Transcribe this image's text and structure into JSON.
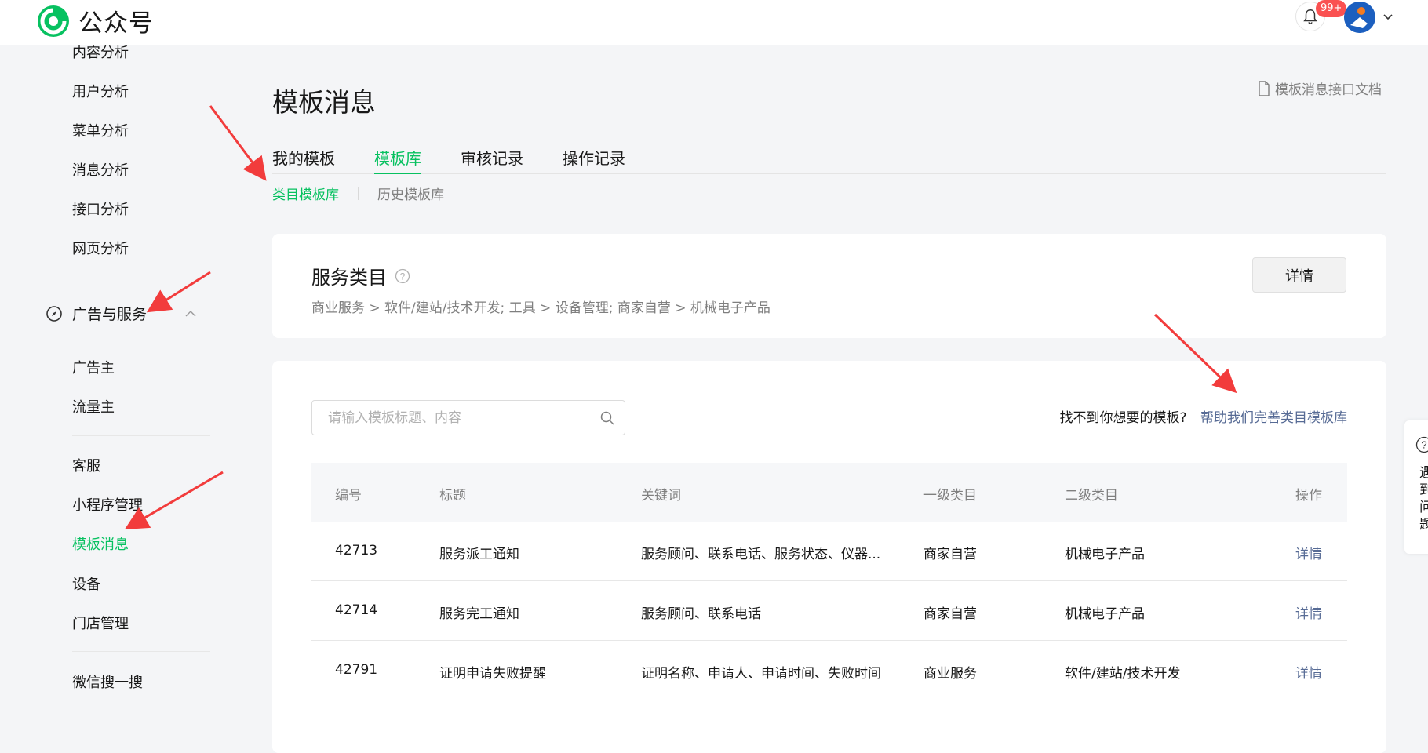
{
  "header": {
    "logo_text": "公众号",
    "notification_badge": "99+"
  },
  "sidebar": {
    "items_top": [
      {
        "label": "内容分析"
      },
      {
        "label": "用户分析"
      },
      {
        "label": "菜单分析"
      },
      {
        "label": "消息分析"
      },
      {
        "label": "接口分析"
      },
      {
        "label": "网页分析"
      }
    ],
    "group_label": "广告与服务",
    "group_items": [
      {
        "label": "广告主"
      },
      {
        "label": "流量主"
      }
    ],
    "items_bottom": [
      {
        "label": "客服"
      },
      {
        "label": "小程序管理"
      },
      {
        "label": "模板消息",
        "active": true
      },
      {
        "label": "设备"
      },
      {
        "label": "门店管理"
      }
    ],
    "items_last": [
      {
        "label": "微信搜一搜"
      }
    ]
  },
  "main": {
    "title": "模板消息",
    "doc_link": "模板消息接口文档",
    "tabs": [
      {
        "label": "我的模板"
      },
      {
        "label": "模板库",
        "active": true
      },
      {
        "label": "审核记录"
      },
      {
        "label": "操作记录"
      }
    ],
    "subtabs": [
      {
        "label": "类目模板库",
        "active": true
      },
      {
        "label": "历史模板库"
      }
    ],
    "service": {
      "title": "服务类目",
      "path": "商业服务 > 软件/建站/技术开发; 工具 > 设备管理; 商家自营 > 机械电子产品",
      "detail_button": "详情"
    },
    "search": {
      "placeholder": "请输入模板标题、内容",
      "value": ""
    },
    "help_question": "找不到你想要的模板?",
    "help_link": "帮助我们完善类目模板库",
    "table": {
      "headers": [
        "编号",
        "标题",
        "关键词",
        "一级类目",
        "二级类目",
        "操作"
      ],
      "rows": [
        {
          "id": "42713",
          "title": "服务派工通知",
          "keywords": "服务顾问、联系电话、服务状态、仪器...",
          "cat1": "商家自营",
          "cat2": "机械电子产品",
          "action": "详情"
        },
        {
          "id": "42714",
          "title": "服务完工通知",
          "keywords": "服务顾问、联系电话",
          "cat1": "商家自营",
          "cat2": "机械电子产品",
          "action": "详情"
        },
        {
          "id": "42791",
          "title": "证明申请失败提醒",
          "keywords": "证明名称、申请人、申请时间、失败时间",
          "cat1": "商业服务",
          "cat2": "软件/建站/技术开发",
          "action": "详情"
        }
      ]
    }
  },
  "floater": {
    "text": "遇到问题"
  },
  "colors": {
    "accent": "#07c160",
    "link": "#576b95",
    "annotation_arrow": "#f23c3c",
    "badge": "#fa5151"
  }
}
